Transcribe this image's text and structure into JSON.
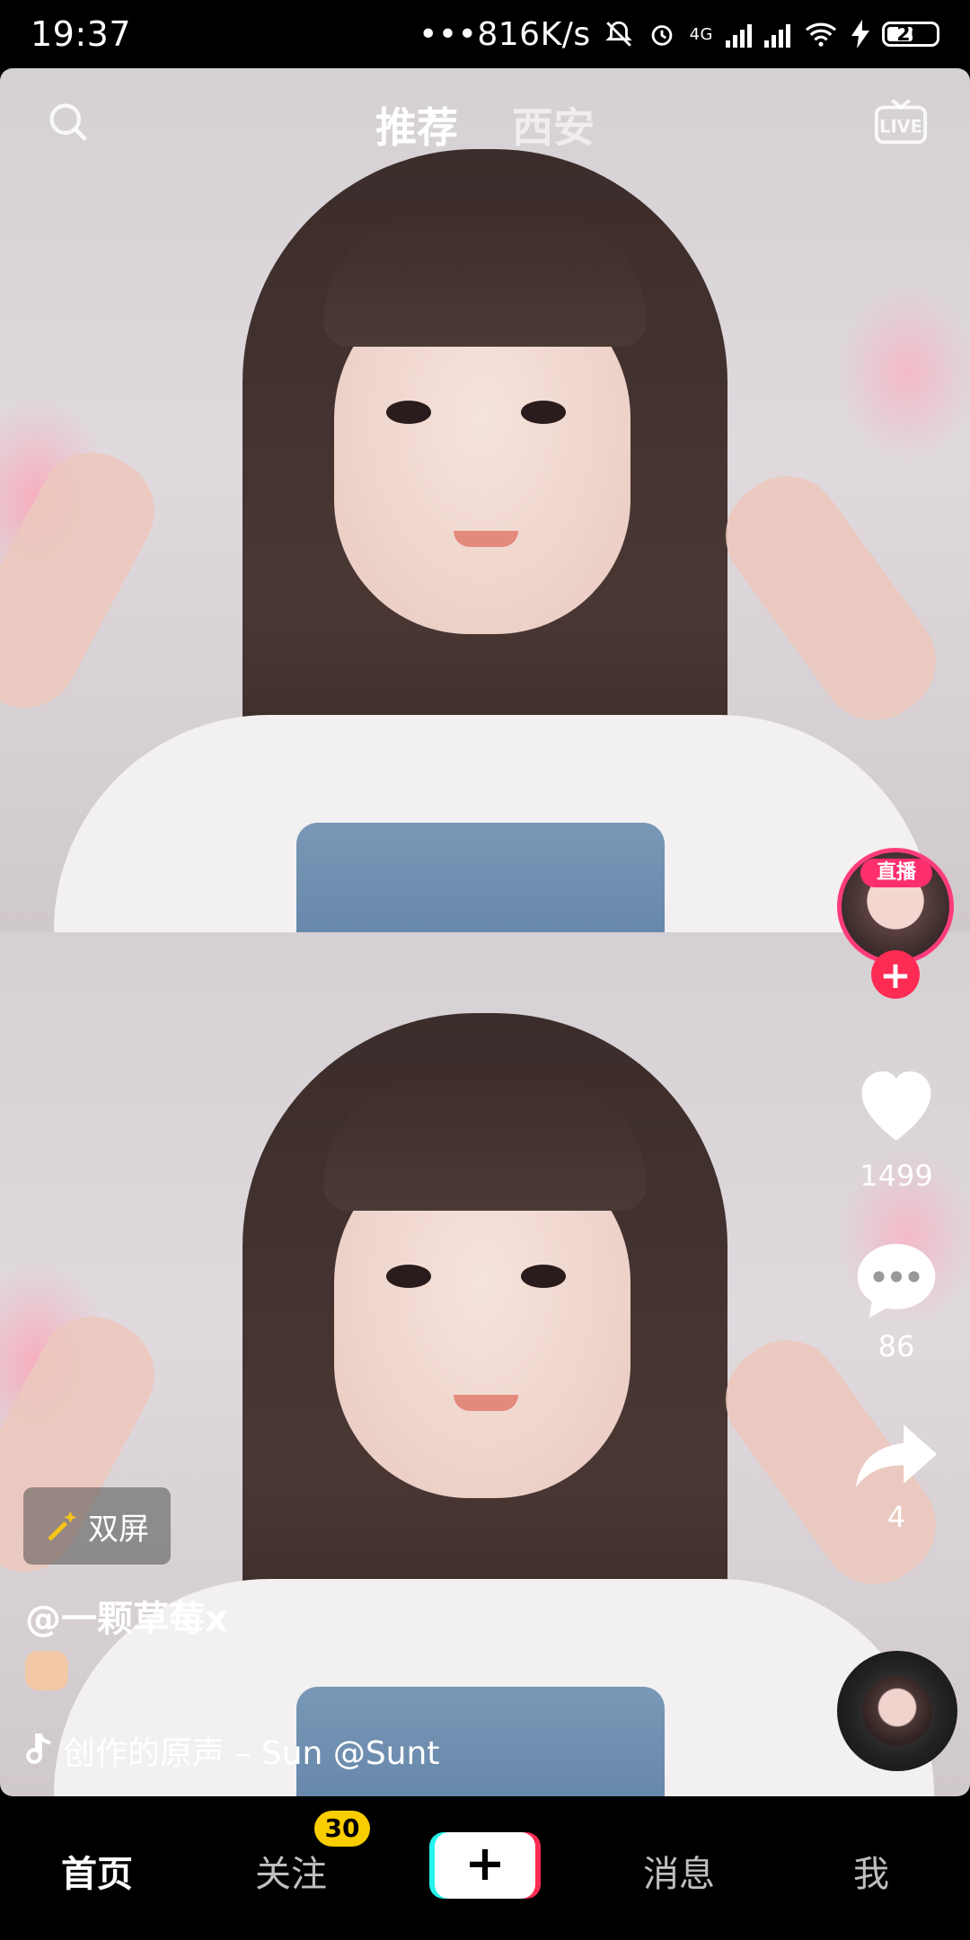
{
  "status_bar": {
    "time": "19:37",
    "network_speed": "•••816K/s",
    "network_type": "4G",
    "battery": "26"
  },
  "top_nav": {
    "tab_recommend": "推荐",
    "tab_city": "西安",
    "live_label": "LIVE"
  },
  "right_rail": {
    "live_badge": "直播",
    "follow_symbol": "+",
    "like_count": "1499",
    "comment_count": "86",
    "share_count": "4"
  },
  "overlay": {
    "duet_label": "双屏",
    "username": "@一颗草莓x",
    "music_text": "创作的原声 – Sun    @Sunt"
  },
  "bottom_nav": {
    "home": "首页",
    "follow": "关注",
    "follow_badge": "30",
    "create": "+",
    "messages": "消息",
    "me": "我"
  }
}
